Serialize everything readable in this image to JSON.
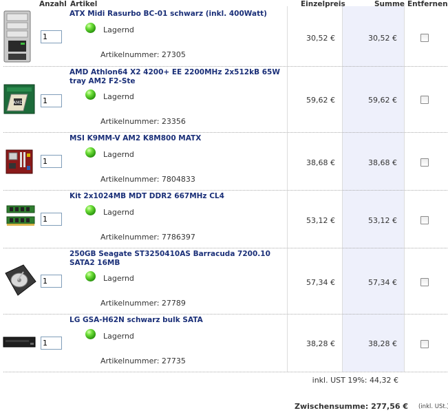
{
  "header": {
    "col_qty": "Anzahl",
    "col_article": "Artikel",
    "col_unit_price": "Einzelpreis",
    "col_sum": "Summe",
    "col_remove": "Entfernen"
  },
  "items": [
    {
      "name": "ATX Midi Rasurbo BC-01 schwarz (inkl. 400Watt)",
      "qty": "1",
      "stock": "Lagernd",
      "artnr": "Artikelnummer: 27305",
      "unit_price": "30,52 €",
      "sum": "30,52 €",
      "image": "pc-case-icon"
    },
    {
      "name": "AMD Athlon64 X2 4200+ EE 2200MHz 2x512kB 65W tray AM2 F2-Ste",
      "qty": "1",
      "stock": "Lagernd",
      "artnr": "Artikelnummer: 23356",
      "unit_price": "59,62 €",
      "sum": "59,62 €",
      "image": "cpu-box-icon"
    },
    {
      "name": "MSI K9MM-V AM2 K8M800 MATX",
      "qty": "1",
      "stock": "Lagernd",
      "artnr": "Artikelnummer: 7804833",
      "unit_price": "38,68 €",
      "sum": "38,68 €",
      "image": "motherboard-icon"
    },
    {
      "name": "Kit 2x1024MB MDT DDR2 667MHz CL4",
      "qty": "1",
      "stock": "Lagernd",
      "artnr": "Artikelnummer: 7786397",
      "unit_price": "53,12 €",
      "sum": "53,12 €",
      "image": "ram-module-icon"
    },
    {
      "name": "250GB Seagate ST3250410AS Barracuda 7200.10 SATA2 16MB",
      "qty": "1",
      "stock": "Lagernd",
      "artnr": "Artikelnummer: 27789",
      "unit_price": "57,34 €",
      "sum": "57,34 €",
      "image": "hard-drive-icon"
    },
    {
      "name": "LG GSA-H62N schwarz bulk SATA",
      "qty": "1",
      "stock": "Lagernd",
      "artnr": "Artikelnummer: 27735",
      "unit_price": "38,28 €",
      "sum": "38,28 €",
      "image": "dvd-drive-icon"
    }
  ],
  "totals": {
    "tax": "inkl. UST 19%: 44,32 €",
    "subtotal": "Zwischensumme: 277,56 €",
    "inkl_note": "(inkl. USt.)"
  },
  "colors": {
    "link": "#1a2f78",
    "sum_column_bg": "#eef0fb",
    "stock_indicator": "#3cc020"
  }
}
